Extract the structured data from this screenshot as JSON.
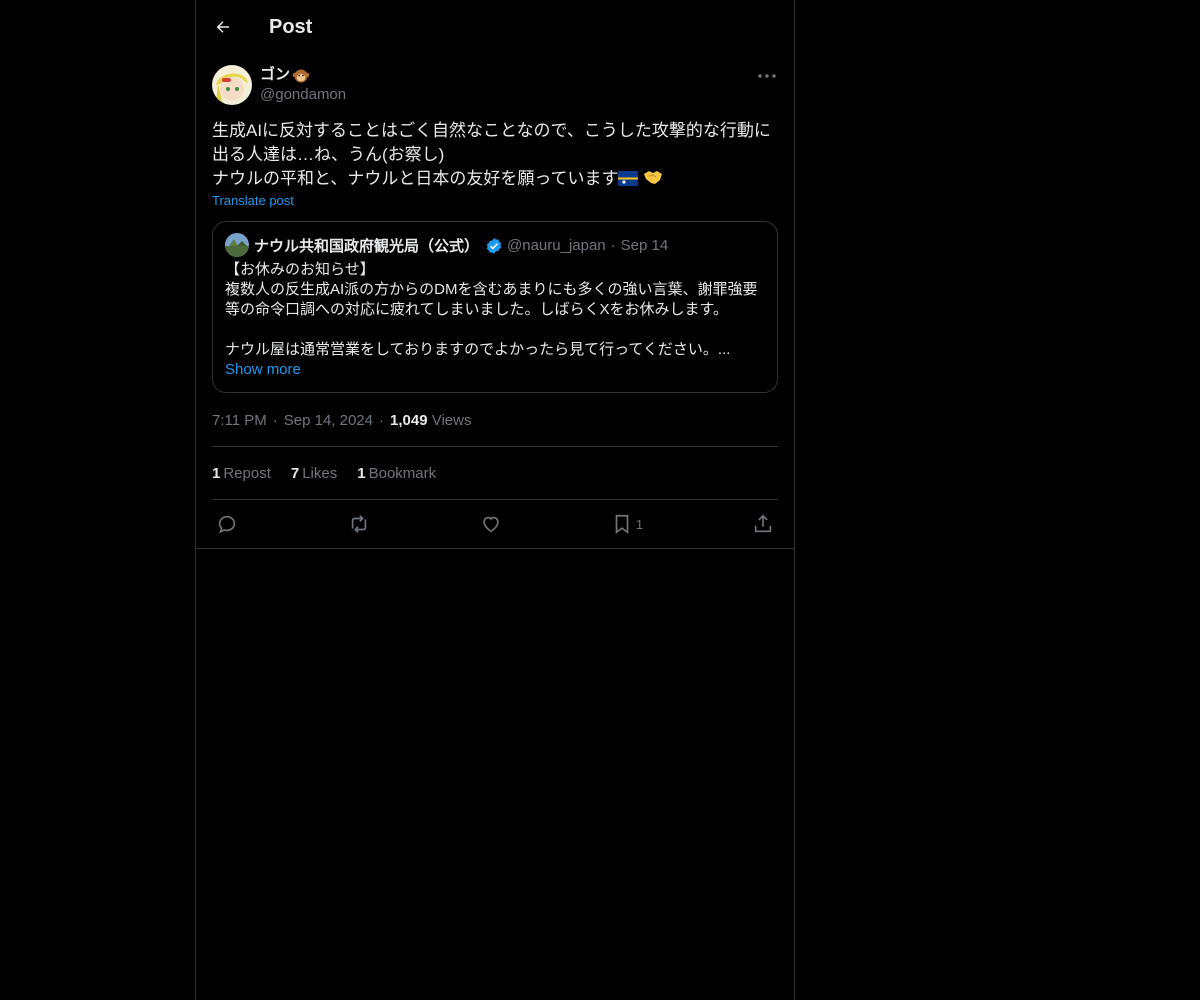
{
  "header": {
    "title": "Post"
  },
  "post": {
    "author": {
      "display_name": "ゴン",
      "handle": "@gondamon"
    },
    "text": "生成AIに反対することはごく自然なことなので、こうした攻撃的な行動に\n出る人達は…ね、うん(お察し)\nナウルの平和と、ナウルと日本の友好を願っています",
    "translate_label": "Translate post",
    "quote": {
      "display_name": "ナウル共和国政府観光局（公式）",
      "handle": "@nauru_japan",
      "dot": "·",
      "date": "Sep 14",
      "text": "【お休みのお知らせ】\n複数人の反生成AI派の方からのDMを含むあまりにも多くの強い言葉、謝罪強要\n等の命令口調への対応に疲れてしまいました。しばらくXをお休みします。\n\nナウル屋は通常営業をしておりますのでよかったら見て行ってください。...",
      "show_more": "Show more"
    },
    "time": "7:11 PM",
    "dot": "·",
    "date": "Sep 14, 2024",
    "views_count": "1,049",
    "views_label": "Views",
    "stats": {
      "reposts": {
        "count": "1",
        "label": "Repost"
      },
      "likes": {
        "count": "7",
        "label": "Likes"
      },
      "bookmarks": {
        "count": "1",
        "label": "Bookmark"
      }
    },
    "actions": {
      "reply_icon": "reply-icon",
      "repost_icon": "repost-icon",
      "like_icon": "heart-icon",
      "bookmark_icon": "bookmark-icon",
      "bookmark_count": "1",
      "share_icon": "share-icon"
    }
  },
  "colors": {
    "background": "#000000",
    "text": "#e7e9ea",
    "muted": "#71767b",
    "accent": "#1d9bf0",
    "border": "#2f3336"
  }
}
